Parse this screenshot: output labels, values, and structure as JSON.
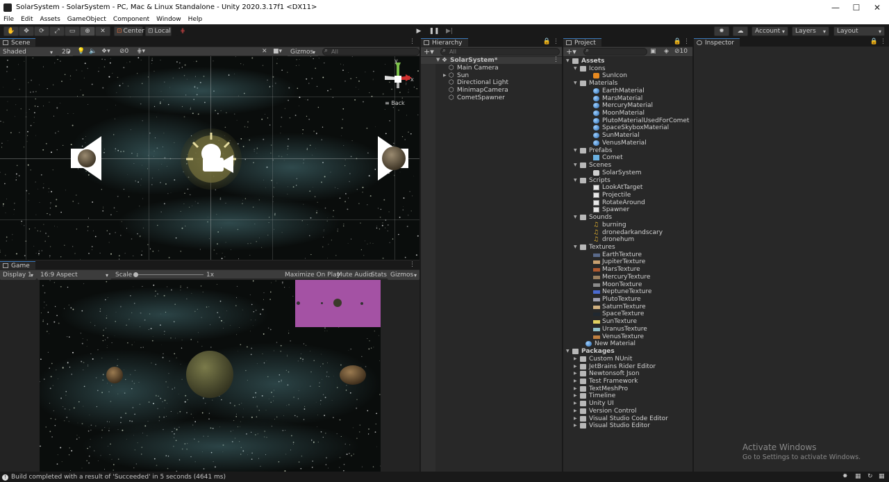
{
  "window": {
    "title": "SolarSystem - SolarSystem - PC, Mac & Linux Standalone - Unity 2020.3.17f1 <DX11>",
    "controls": [
      "—",
      "☐",
      "✕"
    ]
  },
  "menu": [
    "File",
    "Edit",
    "Assets",
    "GameObject",
    "Component",
    "Window",
    "Help"
  ],
  "toolbar": {
    "pivot_label": "Center",
    "space_label": "Local",
    "account_label": "Account",
    "layers_label": "Layers",
    "layout_label": "Layout"
  },
  "scene": {
    "tab_label": "Scene",
    "shading": "Shaded",
    "mode_2d": "2D",
    "hidden_count": "0",
    "gizmos_label": "Gizmos",
    "search_placeholder": "All",
    "gizmo_view_label": "Back",
    "axis_y": "y",
    "axis_x": "x"
  },
  "game": {
    "tab_label": "Game",
    "display": "Display 1",
    "aspect": "16:9 Aspect",
    "scale_label": "Scale",
    "scale_value": "1x",
    "maximize_label": "Maximize On Play",
    "mute_label": "Mute Audio",
    "stats_label": "Stats",
    "gizmos_label": "Gizmos"
  },
  "hierarchy": {
    "tab_label": "Hierarchy",
    "search_placeholder": "All",
    "scene_name": "SolarSystem*",
    "items": [
      "Main Camera",
      "Sun",
      "Directional Light",
      "MinimapCamera",
      "CometSpawner"
    ]
  },
  "project": {
    "tab_label": "Project",
    "hidden_count": "10",
    "root": "Assets",
    "tree": [
      {
        "label": "Icons",
        "depth": 1,
        "type": "folder"
      },
      {
        "label": "SunIcon",
        "depth": 2,
        "type": "image"
      },
      {
        "label": "Materials",
        "depth": 1,
        "type": "folder"
      },
      {
        "label": "EarthMaterial",
        "depth": 2,
        "type": "material"
      },
      {
        "label": "MarsMaterial",
        "depth": 2,
        "type": "material"
      },
      {
        "label": "MercuryMaterial",
        "depth": 2,
        "type": "material"
      },
      {
        "label": "MoonMaterial",
        "depth": 2,
        "type": "material"
      },
      {
        "label": "PlutoMaterialUsedForComet",
        "depth": 2,
        "type": "material"
      },
      {
        "label": "SpaceSkyboxMaterial",
        "depth": 2,
        "type": "material"
      },
      {
        "label": "SunMaterial",
        "depth": 2,
        "type": "material"
      },
      {
        "label": "VenusMaterial",
        "depth": 2,
        "type": "material"
      },
      {
        "label": "Prefabs",
        "depth": 1,
        "type": "folder"
      },
      {
        "label": "Comet",
        "depth": 2,
        "type": "prefab"
      },
      {
        "label": "Scenes",
        "depth": 1,
        "type": "folder"
      },
      {
        "label": "SolarSystem",
        "depth": 2,
        "type": "scene"
      },
      {
        "label": "Scripts",
        "depth": 1,
        "type": "folder"
      },
      {
        "label": "LookAtTarget",
        "depth": 2,
        "type": "script"
      },
      {
        "label": "Projectile",
        "depth": 2,
        "type": "script"
      },
      {
        "label": "RotateAround",
        "depth": 2,
        "type": "script"
      },
      {
        "label": "Spawner",
        "depth": 2,
        "type": "script"
      },
      {
        "label": "Sounds",
        "depth": 1,
        "type": "folder"
      },
      {
        "label": "burning",
        "depth": 2,
        "type": "audio"
      },
      {
        "label": "dronedarkandscary",
        "depth": 2,
        "type": "audio"
      },
      {
        "label": "dronehum",
        "depth": 2,
        "type": "audio"
      },
      {
        "label": "Textures",
        "depth": 1,
        "type": "folder"
      },
      {
        "label": "EarthTexture",
        "depth": 2,
        "type": "texture",
        "color": "#5a6a8a"
      },
      {
        "label": "JupiterTexture",
        "depth": 2,
        "type": "texture",
        "color": "#c8a070"
      },
      {
        "label": "MarsTexture",
        "depth": 2,
        "type": "texture",
        "color": "#b05a30"
      },
      {
        "label": "MercuryTexture",
        "depth": 2,
        "type": "texture",
        "color": "#9a8060"
      },
      {
        "label": "MoonTexture",
        "depth": 2,
        "type": "texture",
        "color": "#8a8a8a"
      },
      {
        "label": "NeptuneTexture",
        "depth": 2,
        "type": "texture",
        "color": "#4a6ad0"
      },
      {
        "label": "PlutoTexture",
        "depth": 2,
        "type": "texture",
        "color": "#a0a0b0"
      },
      {
        "label": "SaturnTexture",
        "depth": 2,
        "type": "texture",
        "color": "#d0b080"
      },
      {
        "label": "SpaceTexture",
        "depth": 2,
        "type": "texture",
        "color": "#202830"
      },
      {
        "label": "SunTexture",
        "depth": 2,
        "type": "texture",
        "color": "#e0d060"
      },
      {
        "label": "UranusTexture",
        "depth": 2,
        "type": "texture",
        "color": "#90c0c8"
      },
      {
        "label": "VenusTexture",
        "depth": 2,
        "type": "texture",
        "color": "#c08040"
      },
      {
        "label": "New Material",
        "depth": 1,
        "type": "material"
      }
    ],
    "packages_root": "Packages",
    "packages": [
      "Custom NUnit",
      "JetBrains Rider Editor",
      "Newtonsoft Json",
      "Test Framework",
      "TextMeshPro",
      "Timeline",
      "Unity UI",
      "Version Control",
      "Visual Studio Code Editor",
      "Visual Studio Editor"
    ]
  },
  "inspector": {
    "tab_label": "Inspector"
  },
  "watermark": {
    "title": "Activate Windows",
    "subtitle": "Go to Settings to activate Windows."
  },
  "status": {
    "message": "Build completed with a result of 'Succeeded' in 5 seconds (4641 ms)"
  },
  "colors": {
    "accent": "#3a79bb",
    "editor_bg": "#282828",
    "minimap_bg": "#a452a4"
  }
}
